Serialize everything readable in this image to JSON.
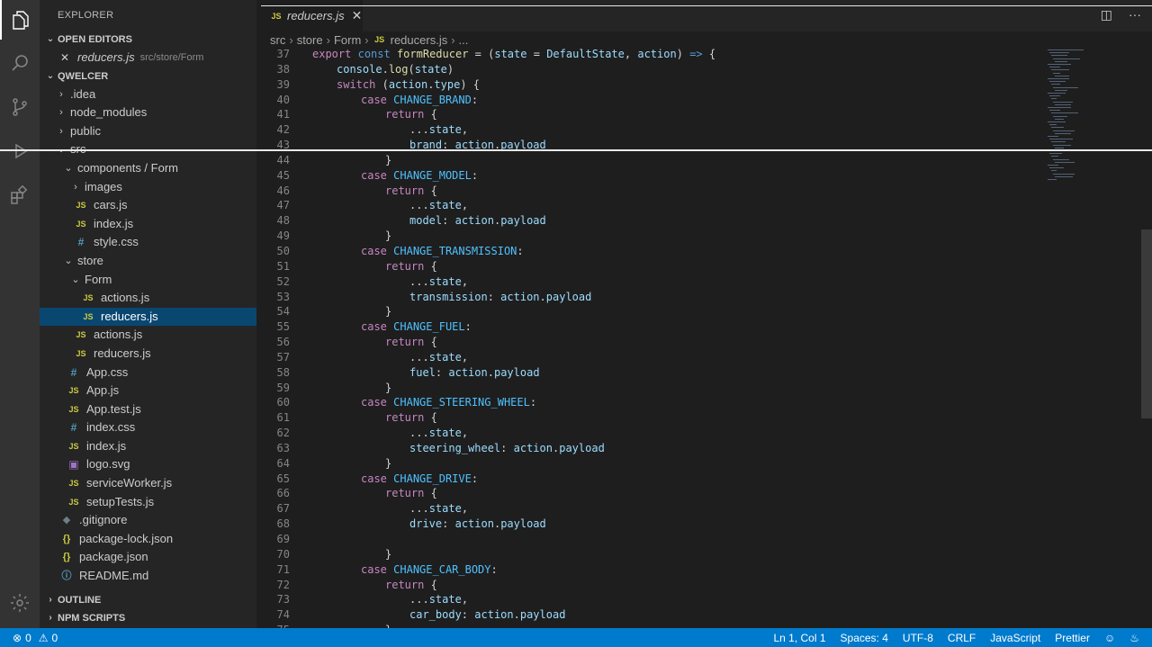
{
  "sidebar": {
    "title": "EXPLORER",
    "open_editors_label": "OPEN EDITORS",
    "open_editor": {
      "file": "reducers.js",
      "path": "src/store/Form"
    },
    "project_label": "QWELCER",
    "tree": [
      {
        "label": ".idea",
        "type": "folder",
        "open": false,
        "depth": 0
      },
      {
        "label": "node_modules",
        "type": "folder",
        "open": false,
        "depth": 0
      },
      {
        "label": "public",
        "type": "folder",
        "open": false,
        "depth": 0
      },
      {
        "label": "src",
        "type": "folder",
        "open": true,
        "depth": 0
      },
      {
        "label": "components / Form",
        "type": "folder",
        "open": true,
        "depth": 1
      },
      {
        "label": "images",
        "type": "folder",
        "open": false,
        "depth": 2
      },
      {
        "label": "cars.js",
        "type": "js",
        "depth": 2
      },
      {
        "label": "index.js",
        "type": "js",
        "depth": 2
      },
      {
        "label": "style.css",
        "type": "css",
        "depth": 2
      },
      {
        "label": "store",
        "type": "folder",
        "open": true,
        "depth": 1
      },
      {
        "label": "Form",
        "type": "folder",
        "open": true,
        "depth": 2
      },
      {
        "label": "actions.js",
        "type": "js",
        "depth": 3
      },
      {
        "label": "reducers.js",
        "type": "js",
        "depth": 3,
        "selected": true
      },
      {
        "label": "actions.js",
        "type": "js",
        "depth": 2
      },
      {
        "label": "reducers.js",
        "type": "js",
        "depth": 2
      },
      {
        "label": "App.css",
        "type": "css",
        "depth": 1
      },
      {
        "label": "App.js",
        "type": "js",
        "depth": 1
      },
      {
        "label": "App.test.js",
        "type": "js",
        "depth": 1
      },
      {
        "label": "index.css",
        "type": "css",
        "depth": 1
      },
      {
        "label": "index.js",
        "type": "js",
        "depth": 1
      },
      {
        "label": "logo.svg",
        "type": "svg",
        "depth": 1
      },
      {
        "label": "serviceWorker.js",
        "type": "js",
        "depth": 1
      },
      {
        "label": "setupTests.js",
        "type": "js",
        "depth": 1
      },
      {
        "label": ".gitignore",
        "type": "git",
        "depth": 0
      },
      {
        "label": "package-lock.json",
        "type": "json",
        "depth": 0
      },
      {
        "label": "package.json",
        "type": "json",
        "depth": 0
      },
      {
        "label": "README.md",
        "type": "info",
        "depth": 0
      }
    ],
    "outline_label": "OUTLINE",
    "npm_label": "NPM SCRIPTS"
  },
  "tab": {
    "label": "reducers.js",
    "icon": "JS"
  },
  "breadcrumb": [
    "src",
    "store",
    "Form",
    "reducers.js",
    "..."
  ],
  "code": [
    {
      "n": "37",
      "indent": 0,
      "html": "<span class='kc'>export</span> <span class='k'>const</span> <span class='fn'>formReducer</span> <span class='pl'>= (</span><span class='id'>state</span> <span class='pl'>=</span> <span class='id'>DefaultState</span><span class='pl'>,</span> <span class='id'>action</span><span class='pl'>)</span> <span class='k'>=&gt;</span> <span class='pl'>{</span>"
    },
    {
      "n": "38",
      "indent": 1,
      "html": "<span class='id'>console</span><span class='pl'>.</span><span class='fn'>log</span><span class='pl'>(</span><span class='id'>state</span><span class='pl'>)</span>"
    },
    {
      "n": "39",
      "indent": 1,
      "html": "<span class='kc'>switch</span> <span class='pl'>(</span><span class='id'>action</span><span class='pl'>.</span><span class='id'>type</span><span class='pl'>) {</span>"
    },
    {
      "n": "40",
      "indent": 2,
      "html": "<span class='kc'>case</span> <span class='cn'>CHANGE_BRAND</span><span class='pl'>:</span>"
    },
    {
      "n": "41",
      "indent": 3,
      "html": "<span class='kc'>return</span> <span class='pl'>{</span>"
    },
    {
      "n": "42",
      "indent": 4,
      "html": "<span class='pl'>...</span><span class='id'>state</span><span class='pl'>,</span>"
    },
    {
      "n": "43",
      "indent": 4,
      "html": "<span class='id'>brand</span><span class='pl'>:</span> <span class='id'>action</span><span class='pl'>.</span><span class='id'>payload</span>"
    },
    {
      "n": "44",
      "indent": 3,
      "html": "<span class='pl'>}</span>"
    },
    {
      "n": "45",
      "indent": 2,
      "html": "<span class='kc'>case</span> <span class='cn'>CHANGE_MODEL</span><span class='pl'>:</span>"
    },
    {
      "n": "46",
      "indent": 3,
      "html": "<span class='kc'>return</span> <span class='pl'>{</span>"
    },
    {
      "n": "47",
      "indent": 4,
      "html": "<span class='pl'>...</span><span class='id'>state</span><span class='pl'>,</span>"
    },
    {
      "n": "48",
      "indent": 4,
      "html": "<span class='id'>model</span><span class='pl'>:</span> <span class='id'>action</span><span class='pl'>.</span><span class='id'>payload</span>"
    },
    {
      "n": "49",
      "indent": 3,
      "html": "<span class='pl'>}</span>"
    },
    {
      "n": "50",
      "indent": 2,
      "html": "<span class='kc'>case</span> <span class='cn'>CHANGE_TRANSMISSION</span><span class='pl'>:</span>"
    },
    {
      "n": "51",
      "indent": 3,
      "html": "<span class='kc'>return</span> <span class='pl'>{</span>"
    },
    {
      "n": "52",
      "indent": 4,
      "html": "<span class='pl'>...</span><span class='id'>state</span><span class='pl'>,</span>"
    },
    {
      "n": "53",
      "indent": 4,
      "html": "<span class='id'>transmission</span><span class='pl'>:</span> <span class='id'>action</span><span class='pl'>.</span><span class='id'>payload</span>"
    },
    {
      "n": "54",
      "indent": 3,
      "html": "<span class='pl'>}</span>"
    },
    {
      "n": "55",
      "indent": 2,
      "html": "<span class='kc'>case</span> <span class='cn'>CHANGE_FUEL</span><span class='pl'>:</span>"
    },
    {
      "n": "56",
      "indent": 3,
      "html": "<span class='kc'>return</span> <span class='pl'>{</span>"
    },
    {
      "n": "57",
      "indent": 4,
      "html": "<span class='pl'>...</span><span class='id'>state</span><span class='pl'>,</span>"
    },
    {
      "n": "58",
      "indent": 4,
      "html": "<span class='id'>fuel</span><span class='pl'>:</span> <span class='id'>action</span><span class='pl'>.</span><span class='id'>payload</span>"
    },
    {
      "n": "59",
      "indent": 3,
      "html": "<span class='pl'>}</span>"
    },
    {
      "n": "60",
      "indent": 2,
      "html": "<span class='kc'>case</span> <span class='cn'>CHANGE_STEERING_WHEEL</span><span class='pl'>:</span>"
    },
    {
      "n": "61",
      "indent": 3,
      "html": "<span class='kc'>return</span> <span class='pl'>{</span>"
    },
    {
      "n": "62",
      "indent": 4,
      "html": "<span class='pl'>...</span><span class='id'>state</span><span class='pl'>,</span>"
    },
    {
      "n": "63",
      "indent": 4,
      "html": "<span class='id'>steering_wheel</span><span class='pl'>:</span> <span class='id'>action</span><span class='pl'>.</span><span class='id'>payload</span>"
    },
    {
      "n": "64",
      "indent": 3,
      "html": "<span class='pl'>}</span>"
    },
    {
      "n": "65",
      "indent": 2,
      "html": "<span class='kc'>case</span> <span class='cn'>CHANGE_DRIVE</span><span class='pl'>:</span>"
    },
    {
      "n": "66",
      "indent": 3,
      "html": "<span class='kc'>return</span> <span class='pl'>{</span>"
    },
    {
      "n": "67",
      "indent": 4,
      "html": "<span class='pl'>...</span><span class='id'>state</span><span class='pl'>,</span>"
    },
    {
      "n": "68",
      "indent": 4,
      "html": "<span class='id'>drive</span><span class='pl'>:</span> <span class='id'>action</span><span class='pl'>.</span><span class='id'>payload</span>"
    },
    {
      "n": "69",
      "indent": 0,
      "html": ""
    },
    {
      "n": "70",
      "indent": 3,
      "html": "<span class='pl'>}</span>"
    },
    {
      "n": "71",
      "indent": 2,
      "html": "<span class='kc'>case</span> <span class='cn'>CHANGE_CAR_BODY</span><span class='pl'>:</span>"
    },
    {
      "n": "72",
      "indent": 3,
      "html": "<span class='kc'>return</span> <span class='pl'>{</span>"
    },
    {
      "n": "73",
      "indent": 4,
      "html": "<span class='pl'>...</span><span class='id'>state</span><span class='pl'>,</span>"
    },
    {
      "n": "74",
      "indent": 4,
      "html": "<span class='id'>car_body</span><span class='pl'>:</span> <span class='id'>action</span><span class='pl'>.</span><span class='id'>payload</span>"
    },
    {
      "n": "75",
      "indent": 3,
      "html": "<span class='pl'>}</span>"
    }
  ],
  "status": {
    "errors": "0",
    "warnings": "0",
    "position": "Ln 1, Col 1",
    "spaces": "Spaces: 4",
    "encoding": "UTF-8",
    "eol": "CRLF",
    "language": "JavaScript",
    "formatter": "Prettier"
  },
  "colors": {
    "status_bar": "#007acc",
    "selection": "#094771",
    "keyword": "#c586c0",
    "function": "#dcdcaa",
    "constant": "#4fc1ff"
  }
}
